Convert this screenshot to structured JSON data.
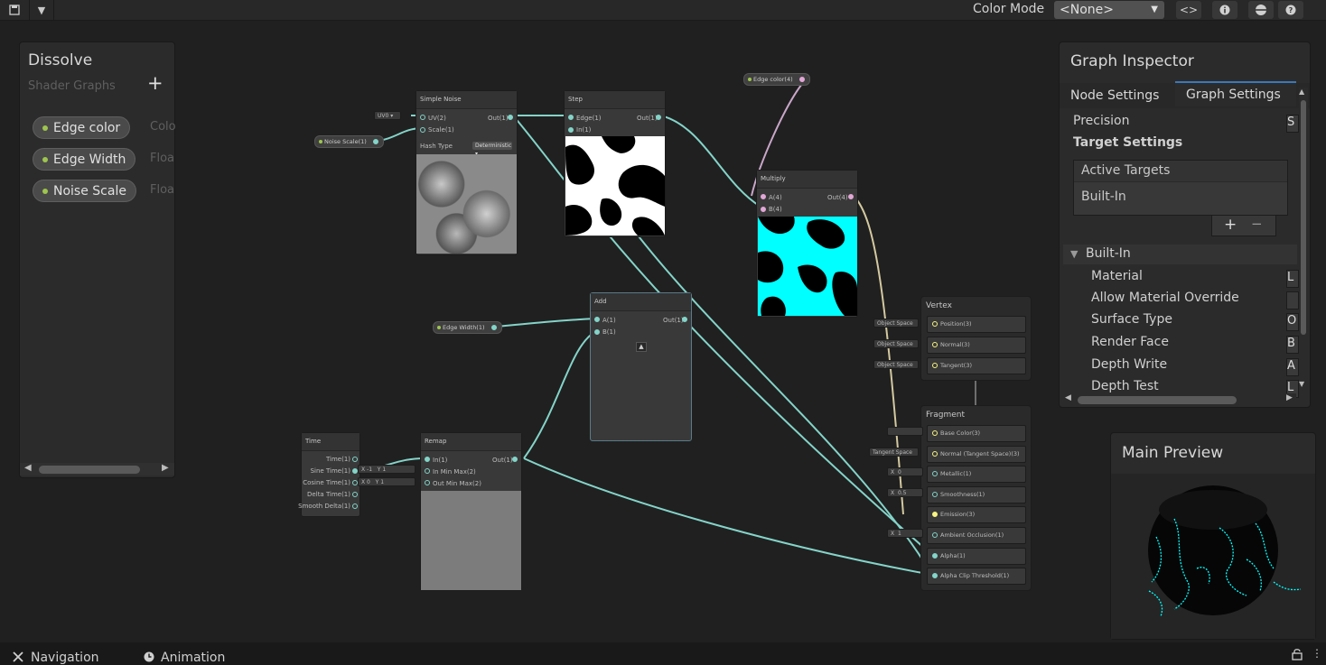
{
  "toolbar": {
    "save_icon": "save-icon",
    "dropdown_icon": "chevron-down-icon",
    "color_mode_label": "Color Mode",
    "color_mode_value": "<None>",
    "icons": [
      "code-toggle-icon",
      "info-icon",
      "sphere-preview-icon",
      "help-icon"
    ]
  },
  "blackboard": {
    "title": "Dissolve",
    "subtitle": "Shader Graphs",
    "add_label": "+",
    "properties": [
      {
        "name": "Edge color",
        "type": "Colo"
      },
      {
        "name": "Edge Width",
        "type": "Floa"
      },
      {
        "name": "Noise Scale",
        "type": "Floa"
      }
    ]
  },
  "nodes": {
    "simple_noise": {
      "title": "Simple Noise",
      "in_uv": "UV(2)",
      "in_scale": "Scale(1)",
      "out": "Out(1)",
      "hash_label": "Hash Type",
      "hash_value": "Deterministic",
      "uv_input": "UV0"
    },
    "step": {
      "title": "Step",
      "in_edge": "Edge(1)",
      "in_in": "In(1)",
      "out": "Out(1)"
    },
    "multiply": {
      "title": "Multiply",
      "in_a": "A(4)",
      "in_b": "B(4)",
      "out": "Out(4)"
    },
    "add": {
      "title": "Add",
      "in_a": "A(1)",
      "in_b": "B(1)",
      "out": "Out(1)"
    },
    "time": {
      "title": "Time",
      "outs": [
        "Time(1)",
        "Sine Time(1)",
        "Cosine Time(1)",
        "Delta Time(1)",
        "Smooth Delta(1)"
      ]
    },
    "remap": {
      "title": "Remap",
      "in_in": "In(1)",
      "in_min_max": "In Min Max(2)",
      "out_min_max": "Out Min Max(2)",
      "out": "Out(1)",
      "in_min_max_x": "-1",
      "in_min_max_y": "1",
      "out_min_max_x": "0",
      "out_min_max_y": "1",
      "x_label": "X",
      "y_label": "Y"
    },
    "prop_edge_color": "Edge color(4)",
    "prop_noise_scale": "Noise Scale(1)",
    "prop_edge_width": "Edge Width(1)"
  },
  "master": {
    "vertex_title": "Vertex",
    "vertex_blocks": [
      "Position(3)",
      "Normal(3)",
      "Tangent(3)"
    ],
    "vertex_inputs": [
      "Object Space",
      "Object Space",
      "Object Space"
    ],
    "fragment_title": "Fragment",
    "fragment_blocks": [
      "Base Color(3)",
      "Normal (Tangent Space)(3)",
      "Metallic(1)",
      "Smoothness(1)",
      "Emission(3)",
      "Ambient Occlusion(1)",
      "Alpha(1)",
      "Alpha Clip Threshold(1)"
    ],
    "fragment_inputs": {
      "normal": "Tangent Space",
      "metallic_x": "X",
      "metallic": "0",
      "smoothness_x": "X",
      "smoothness": "0.5",
      "ao_x": "X",
      "ao": "1"
    }
  },
  "inspector": {
    "title": "Graph Inspector",
    "tabs": [
      "Node Settings",
      "Graph Settings"
    ],
    "active_tab": "Graph Settings",
    "precision_label": "Precision",
    "precision_value": "S",
    "target_settings_label": "Target Settings",
    "active_targets_label": "Active Targets",
    "targets": [
      "Built-In"
    ],
    "add_label": "+",
    "remove_label": "−",
    "section": "Built-In",
    "rows": [
      {
        "label": "Material",
        "value": "L"
      },
      {
        "label": "Allow Material Override",
        "value": ""
      },
      {
        "label": "Surface Type",
        "value": "O"
      },
      {
        "label": "Render Face",
        "value": "B"
      },
      {
        "label": "Depth Write",
        "value": "A"
      },
      {
        "label": "Depth Test",
        "value": "L"
      }
    ]
  },
  "main_preview": {
    "title": "Main Preview"
  },
  "statusbar": {
    "navigation": "Navigation",
    "animation": "Animation"
  },
  "colors": {
    "vector1": "#84d4c9",
    "vector4": "#e1a7d6",
    "vector3": "#f7f483",
    "property": "#9ec54f",
    "emission": "#00ffff"
  }
}
